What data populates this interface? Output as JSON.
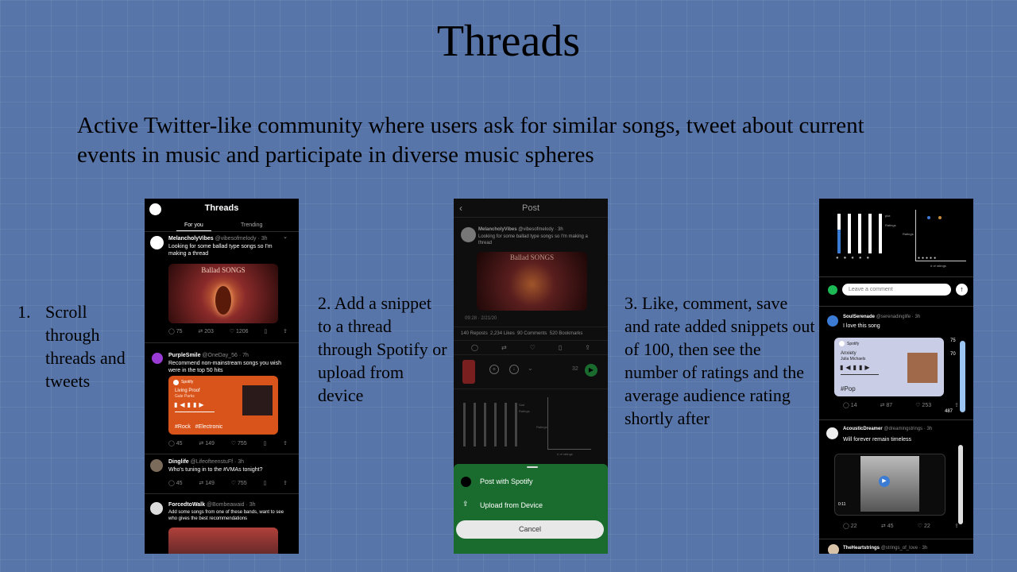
{
  "slide": {
    "title": "Threads",
    "subtitle": "Active Twitter-like community where users ask for similar songs, tweet about current events in music and participate in diverse music spheres",
    "step1_num": "1.",
    "step1_text": "Scroll through threads and tweets",
    "step2_text": "2. Add a snippet to a thread through Spotify or upload from device",
    "step3_text": "3. Like, comment, save and rate added snippets out of 100, then see the number of ratings and the average audience rating shortly after"
  },
  "phone1": {
    "header_title": "Threads",
    "tab_for_you": "For you",
    "tab_trending": "Trending",
    "post1": {
      "user": "MelancholyVibes",
      "handle": "@vibesofmelody · 3h",
      "text": "Looking for some ballad type songs so I'm making a thread",
      "image_caption": "Ballad SONGS",
      "counts": [
        "75",
        "203",
        "1206",
        "",
        ""
      ]
    },
    "post2": {
      "user": "PurpleSmile",
      "handle": "@OneDay_56 · 7h",
      "text": "Recommend non-mainstream songs you wish were in the top 50 hits",
      "card_brand": "Spotify",
      "track": "Living Proof",
      "artist": "Gale Parks",
      "tags": "#Rock   #Electronic",
      "counts": [
        "45",
        "149",
        "755"
      ]
    },
    "post3": {
      "user": "Dinglife",
      "handle": "@LifeofteenstuFf · 3h",
      "text": "Who's tuning in to the #VMAs tonight?",
      "counts": [
        "45",
        "149",
        "755"
      ]
    },
    "post4": {
      "user": "ForcedtoWalk",
      "handle": "@Bombeawaid · 3h",
      "text": "Add some songs from one of these bands, want to see who gives the best recommendations"
    }
  },
  "phone2": {
    "back_icon": "chevron-left-icon",
    "header_title": "Post",
    "post": {
      "user": "MelancholyVibes",
      "handle": "@vibesofmelody · 3h",
      "text": "Looking for some ballad type songs so I'm making a thread",
      "image_caption": "Ballad SONGS",
      "timestamp": "09:28 · 2/21/20"
    },
    "stats": "140 Reposts  2,234 Likes  90 Comments  520 Bookmarks",
    "player_count": "32",
    "chart_legend": [
      "Sad",
      "Ratings"
    ],
    "chart_ylabel": "Ratings",
    "chart_xlabel": "# of ratings",
    "sheet": {
      "post_spotify": "Post with Spotify",
      "upload_device": "Upload from Device",
      "cancel": "Cancel"
    }
  },
  "phone3": {
    "chart_legend": [
      "plot",
      "Ratings"
    ],
    "chart_ylabel": "Ratings",
    "chart_xlabel": "# of ratings",
    "comment_placeholder": "Leave a comment",
    "post1": {
      "user": "SoulSerenade",
      "handle": "@serenadinglife · 3h",
      "text": "I love this song",
      "card_brand": "Spotify",
      "track": "Anxiety",
      "artist": "Julia Michaels",
      "tag": "#Pop",
      "rating_top": "75",
      "rating_mid": "70",
      "rating_count": "487",
      "counts": [
        "14",
        "87",
        "253"
      ]
    },
    "post2": {
      "user": "AcousticDreamer",
      "handle": "@dreamingstrings · 3h",
      "text": "Will forever remain timeless",
      "video_time": "0:11",
      "counts": [
        "22",
        "45",
        "22"
      ]
    },
    "post3": {
      "user": "TheHeartstrings",
      "handle": "@strings_of_love · 3h"
    }
  },
  "colors": {
    "background": "#5775a9",
    "spotify_green": "#1db954",
    "card_orange": "#d9541a",
    "sheet_green": "#1a6b2e"
  }
}
